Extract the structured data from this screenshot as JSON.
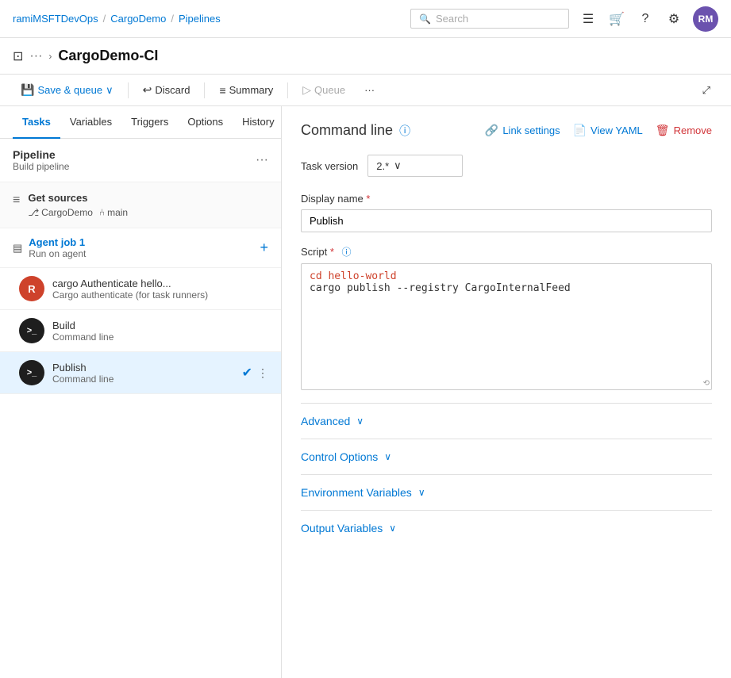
{
  "topnav": {
    "org": "ramiMSFTDevOps",
    "project": "CargoDemo",
    "section": "Pipelines",
    "search_placeholder": "Search",
    "avatar_initials": "RM"
  },
  "page_header": {
    "page_icon": "⊞",
    "breadcrumb_dots": "···",
    "chevron": "›",
    "title": "CargoDemo-CI"
  },
  "left_tabs": {
    "items": [
      {
        "id": "tasks",
        "label": "Tasks",
        "active": true
      },
      {
        "id": "variables",
        "label": "Variables",
        "active": false
      },
      {
        "id": "triggers",
        "label": "Triggers",
        "active": false
      },
      {
        "id": "options",
        "label": "Options",
        "active": false
      },
      {
        "id": "history",
        "label": "History",
        "active": false
      }
    ]
  },
  "toolbar": {
    "save_queue_label": "Save & queue",
    "discard_label": "Discard",
    "summary_label": "Summary",
    "queue_label": "Queue",
    "more_icon": "···"
  },
  "pipeline": {
    "name": "Pipeline",
    "sub": "Build pipeline"
  },
  "get_sources": {
    "name": "Get sources",
    "repo": "CargoDemo",
    "branch": "main"
  },
  "agent_job": {
    "name": "Agent job 1",
    "sub": "Run on agent"
  },
  "tasks": [
    {
      "id": "cargo-auth",
      "icon_type": "rust",
      "icon_char": "R",
      "name": "cargo Authenticate hello...",
      "sub": "Cargo authenticate (for task runners)",
      "active": false,
      "checked": false
    },
    {
      "id": "build",
      "icon_type": "cmd",
      "icon_char": ">_",
      "name": "Build",
      "sub": "Command line",
      "active": false,
      "checked": false
    },
    {
      "id": "publish",
      "icon_type": "cmd",
      "icon_char": ">_",
      "name": "Publish",
      "sub": "Command line",
      "active": true,
      "checked": true
    }
  ],
  "right_panel": {
    "cmd_title": "Command line",
    "link_settings_label": "Link settings",
    "view_yaml_label": "View YAML",
    "remove_label": "Remove",
    "task_version_label": "Task version",
    "task_version_value": "2.*",
    "display_name_label": "Display name",
    "display_name_required": "*",
    "display_name_value": "Publish",
    "script_label": "Script",
    "script_required": "*",
    "script_line_1": "cd hello-world",
    "script_line_2": "cargo publish --registry CargoInternalFeed",
    "advanced_label": "Advanced",
    "control_options_label": "Control Options",
    "env_variables_label": "Environment Variables",
    "output_variables_label": "Output Variables"
  }
}
